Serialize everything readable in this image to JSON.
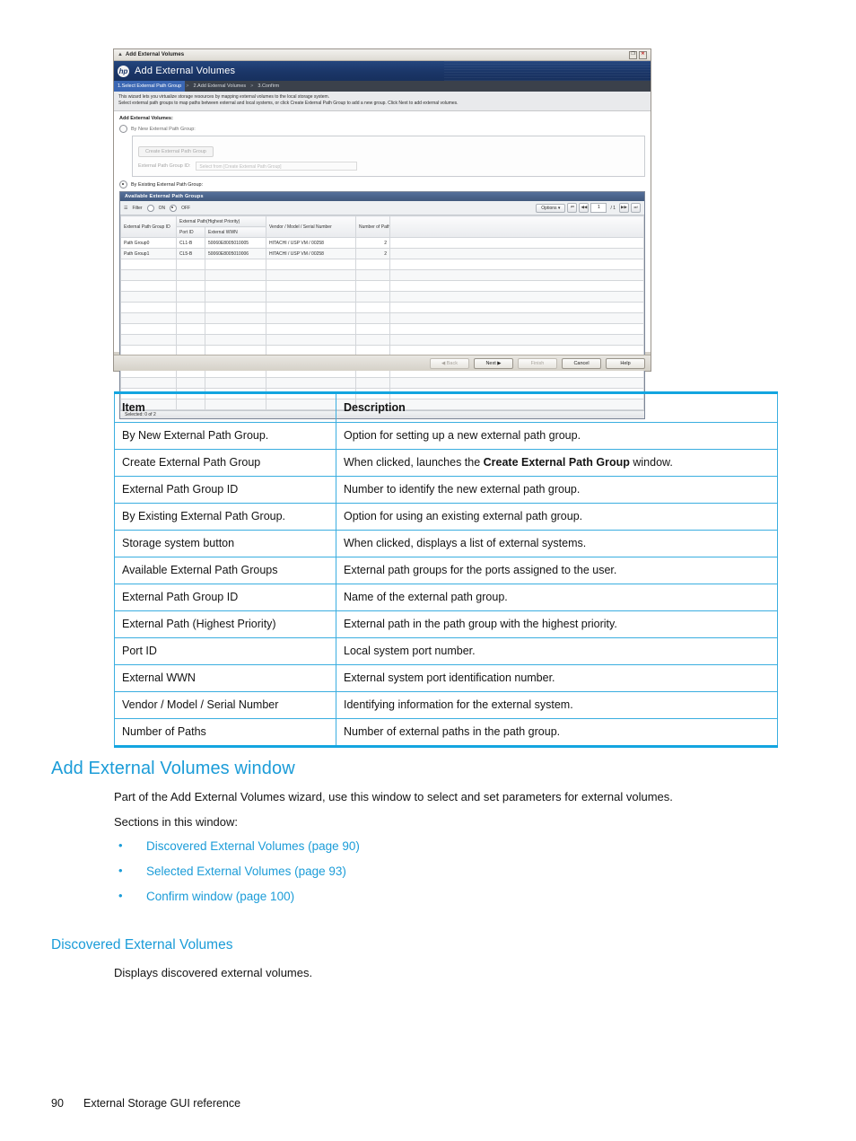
{
  "figure": {
    "window_titlebar": {
      "icon": "window-icon",
      "title": "Add External Volumes",
      "restore_label": "❐",
      "close_label": "✕"
    },
    "banner": {
      "logo": "hp-logo",
      "title": "Add External Volumes"
    },
    "breadcrumb": {
      "steps": [
        "1.Select External Path Group",
        "2.Add External Volumes",
        "3.Confirm"
      ],
      "separator": ">"
    },
    "wizard_description": [
      "This wizard lets you virtualize storage resources by mapping external volumes to the local storage system.",
      "Select external path groups to map paths between external and local systems, or click Create External Path Group to add a new group. Click Next to add external volumes."
    ],
    "section_label": "Add External Volumes:",
    "option_new": {
      "label": "By New External Path Group:",
      "selected": false,
      "create_button": "Create External Path Group",
      "group_id_label": "External Path Group ID:",
      "group_id_placeholder": "Select from [Create External Path Group]",
      "group_id_value": ""
    },
    "option_existing": {
      "label": "By Existing External Path Group:",
      "selected": true
    },
    "panel": {
      "title": "Available External Path Groups",
      "toolbar": {
        "filter_icon": "filter-icon",
        "filter_label": "Filter",
        "on_label": "ON",
        "off_label": "OFF",
        "filter_state": "OFF",
        "options_label": "Options",
        "options_caret": "▾",
        "first_page_icon": "⏮",
        "prev_page_icon": "◀◀",
        "page_value": "1",
        "page_total": "/ 1",
        "next_page_icon": "▶▶",
        "last_page_icon": "⏭"
      },
      "columns": {
        "group_id": "External Path Group ID",
        "external_path_group": "External Path(Highest Priority)",
        "port_id": "Port ID",
        "external_wwn": "External WWN",
        "vendor": "Vendor / Model / Serial Number",
        "num_paths": "Number of Paths"
      },
      "rows": [
        {
          "group_id": "Path Group0",
          "port_id": "CL1-B",
          "external_wwn": "50060E8005010005",
          "vendor": "HITACHI / USP VM / 00258",
          "num_paths": "2"
        },
        {
          "group_id": "Path Group1",
          "port_id": "CL5-B",
          "external_wwn": "50060E8005010006",
          "vendor": "HITACHI / USP VM / 00258",
          "num_paths": "2"
        }
      ],
      "status": "Selected: 0  of  2"
    },
    "footer_buttons": {
      "back": "◀ Back",
      "next": "Next ▶",
      "finish": "Finish",
      "cancel": "Cancel",
      "help": "Help"
    }
  },
  "doc_table": {
    "headers": {
      "item": "Item",
      "description": "Description"
    },
    "rows": [
      {
        "item": "By New External Path Group.",
        "desc_pre": "Option for setting up a new external path group.",
        "desc_bold": "",
        "desc_post": ""
      },
      {
        "item": "Create External Path Group",
        "desc_pre": "When clicked, launches the ",
        "desc_bold": "Create External Path Group",
        "desc_post": " window."
      },
      {
        "item": "External Path Group ID",
        "desc_pre": "Number to identify the new external path group.",
        "desc_bold": "",
        "desc_post": ""
      },
      {
        "item": "By Existing External Path Group.",
        "desc_pre": "Option for using an existing external path group.",
        "desc_bold": "",
        "desc_post": ""
      },
      {
        "item": "Storage system button",
        "desc_pre": "When clicked, displays a list of external systems.",
        "desc_bold": "",
        "desc_post": ""
      },
      {
        "item": "Available External Path Groups",
        "desc_pre": "External path groups for the ports assigned to the user.",
        "desc_bold": "",
        "desc_post": ""
      },
      {
        "item": "External Path Group ID",
        "desc_pre": "Name of the external path group.",
        "desc_bold": "",
        "desc_post": ""
      },
      {
        "item": "External Path (Highest Priority)",
        "desc_pre": "External path in the path group with the highest priority.",
        "desc_bold": "",
        "desc_post": ""
      },
      {
        "item": "Port ID",
        "desc_pre": "Local system port number.",
        "desc_bold": "",
        "desc_post": ""
      },
      {
        "item": "External WWN",
        "desc_pre": "External system port identification number.",
        "desc_bold": "",
        "desc_post": ""
      },
      {
        "item": "Vendor / Model / Serial Number",
        "desc_pre": "Identifying information for the external system.",
        "desc_bold": "",
        "desc_post": ""
      },
      {
        "item": "Number of Paths",
        "desc_pre": "Number of external paths in the path group.",
        "desc_bold": "",
        "desc_post": ""
      }
    ]
  },
  "content": {
    "section_title": "Add External Volumes window",
    "paragraph_1": "Part of the Add External Volumes wizard, use this window to select and set parameters for external volumes.",
    "paragraph_2": "Sections in this window:",
    "links": [
      "Discovered External Volumes (page 90)",
      "Selected External Volumes (page 93)",
      "Confirm window (page 100)"
    ],
    "subsection_title": "Discovered External Volumes",
    "subsection_body": "Displays discovered external volumes."
  },
  "page_footer": {
    "page_number": "90",
    "chapter": "External Storage GUI reference"
  }
}
